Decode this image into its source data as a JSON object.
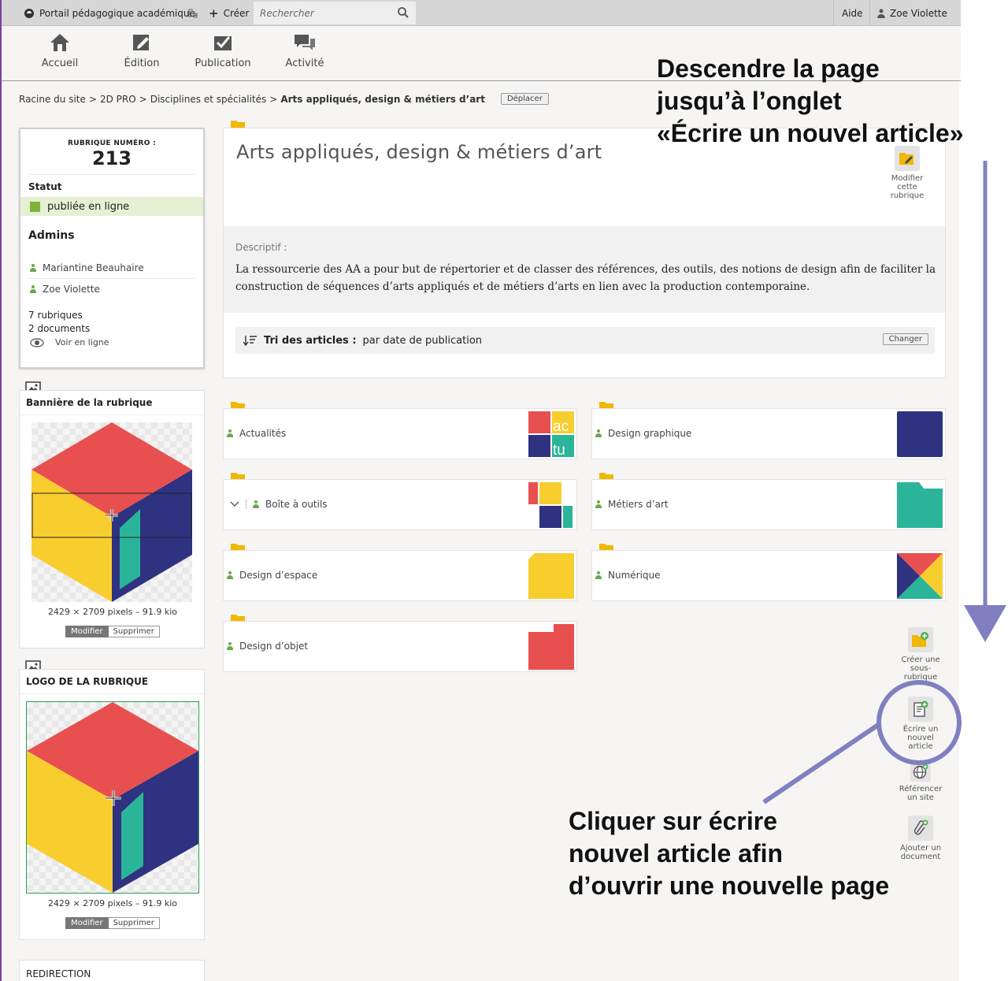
{
  "topbar": {
    "site_name": "Portail pédagogique académique",
    "create_label": "Créer",
    "search_placeholder": "Rechercher",
    "help_label": "Aide",
    "user_label": "Zoe Violette"
  },
  "toolbar": {
    "items": [
      {
        "label": "Accueil",
        "icon": "home-icon"
      },
      {
        "label": "Édition",
        "icon": "edit-icon"
      },
      {
        "label": "Publication",
        "icon": "check-icon"
      },
      {
        "label": "Activité",
        "icon": "chat-icon"
      }
    ]
  },
  "breadcrumb": {
    "items": [
      "Racine du site",
      "2D PRO",
      "Disciplines et spécialités"
    ],
    "separator": ">",
    "current": "Arts appliqués, design & métiers d’art",
    "move_label": "Déplacer"
  },
  "info": {
    "number_label": "RUBRIQUE NUMÉRO :",
    "number": "213",
    "status_title": "Statut",
    "status_value": "publiée en ligne",
    "status_color": "#7fb23a",
    "admins_title": "Admins",
    "admins": [
      "Mariantine Beauhaire",
      "Zoe Violette"
    ],
    "count_rubriques": "7 rubriques",
    "count_documents": "2 documents",
    "view_online": "Voir en ligne"
  },
  "banner": {
    "title": "Bannière de la rubrique",
    "dims": "2429 × 2709 pixels – 91.9 kio",
    "modify_label": "Modifier",
    "delete_label": "Supprimer"
  },
  "logo": {
    "title": "LOGO DE LA RUBRIQUE",
    "dims": "2429 × 2709 pixels – 91.9 kio",
    "modify_label": "Modifier",
    "delete_label": "Supprimer"
  },
  "redirection_title": "REDIRECTION",
  "rubrique": {
    "title": "Arts appliqués, design & métiers d’art",
    "modify_label": "Modifier cette rubrique",
    "desc_label": "Descriptif :",
    "description": "La ressourcerie des AA a pour but de répertorier et de classer des références, des outils, des notions de design afin de faciliter la construction de séquences d’arts appliqués et de métiers d’arts en lien avec la production contemporaine.",
    "sort_label": "Tri des articles :",
    "sort_value": "par date de publication",
    "change_label": "Changer"
  },
  "subrubriques": [
    {
      "label": "Actualités",
      "thumb": "actu"
    },
    {
      "label": "Design graphique",
      "thumb": "navy"
    },
    {
      "label": "Boîte à outils",
      "thumb": "blocks"
    },
    {
      "label": "Métiers d’art",
      "thumb": "folder-teal"
    },
    {
      "label": "Design d’espace",
      "thumb": "yellow"
    },
    {
      "label": "Numérique",
      "thumb": "triangles"
    },
    {
      "label": "Design d’objet",
      "thumb": "red-notch"
    }
  ],
  "actions": [
    {
      "label": "Créer une sous-rubrique",
      "icon": "new-folder-icon"
    },
    {
      "label": "Écrire un nouvel article",
      "icon": "new-article-icon"
    },
    {
      "label": "Référencer un site",
      "icon": "globe-icon"
    },
    {
      "label": "Ajouter un document",
      "icon": "paperclip-icon"
    }
  ],
  "annotations": {
    "top": "Descendre la page jusqu’à l’onglet «Écrire un nouvel article»",
    "top_lines": [
      "Descendre la page",
      "jusqu’à l’onglet",
      "«Écrire un nouvel article»"
    ],
    "bottom_lines": [
      "Cliquer sur écrire",
      "nouvel article afin",
      "d’ouvrir une nouvelle page"
    ],
    "color": "#8080c0"
  },
  "colors": {
    "red": "#e85050",
    "yellow": "#f8cd2e",
    "navy": "#2e3280",
    "teal": "#2ab59a",
    "folder": "#f0b800"
  }
}
